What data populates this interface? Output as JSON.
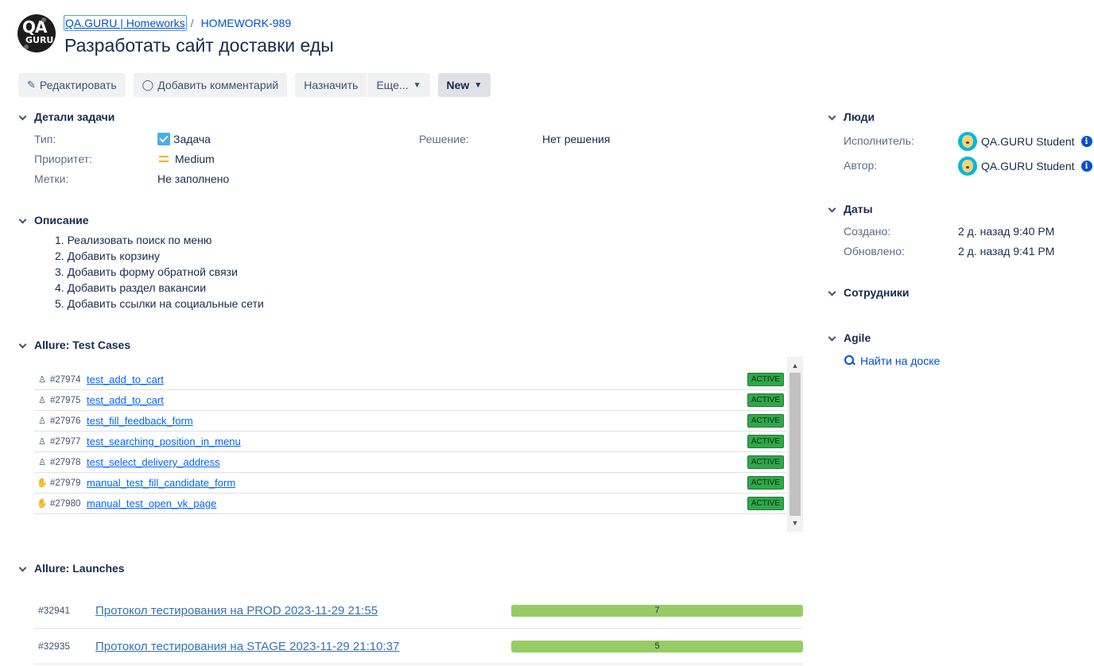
{
  "header": {
    "project_logo_text": "QA GURU",
    "project_name": "QA.GURU | Homeworks",
    "separator": "/",
    "issue_key": "HOMEWORK-989",
    "summary": "Разработать сайт доставки еды"
  },
  "toolbar": {
    "edit": "Редактировать",
    "comment": "Добавить комментарий",
    "assign": "Назначить",
    "more": "Еще...",
    "status": "New"
  },
  "details": {
    "title": "Детали задачи",
    "type_label": "Тип:",
    "type_value": "Задача",
    "priority_label": "Приоритет:",
    "priority_value": "Medium",
    "labels_label": "Метки:",
    "labels_value": "Не заполнено",
    "resolution_label": "Решение:",
    "resolution_value": "Нет решения"
  },
  "description": {
    "title": "Описание",
    "items": [
      "1. Реализовать поиск по меню",
      "2. Добавить корзину",
      "3. Добавить форму обратной связи",
      "4. Добавить раздел вакансии",
      "5. Добавить ссылки на социальные сети"
    ]
  },
  "test_cases": {
    "title": "Allure: Test Cases",
    "rows": [
      {
        "kind": "automated-icon",
        "id": "#27974",
        "name": "test_add_to_cart",
        "status": "ACTIVE"
      },
      {
        "kind": "automated-icon",
        "id": "#27975",
        "name": "test_add_to_cart",
        "status": "ACTIVE"
      },
      {
        "kind": "automated-icon",
        "id": "#27976",
        "name": "test_fill_feedback_form",
        "status": "ACTIVE"
      },
      {
        "kind": "automated-icon",
        "id": "#27977",
        "name": "test_searching_position_in_menu",
        "status": "ACTIVE"
      },
      {
        "kind": "automated-icon",
        "id": "#27978",
        "name": "test_select_delivery_address",
        "status": "ACTIVE"
      },
      {
        "kind": "manual-icon",
        "id": "#27979",
        "name": "manual_test_fill_candidate_form",
        "status": "ACTIVE"
      },
      {
        "kind": "manual-icon",
        "id": "#27980",
        "name": "manual_test_open_vk_page",
        "status": "ACTIVE"
      }
    ]
  },
  "launches": {
    "title": "Allure: Launches",
    "rows": [
      {
        "id": "#32941",
        "name": "Протокол тестирования на PROD 2023-11-29 21:55",
        "passed": "7"
      },
      {
        "id": "#32935",
        "name": "Протокол тестирования на STAGE 2023-11-29 21:10:37",
        "passed": "5"
      }
    ]
  },
  "people": {
    "title": "Люди",
    "assignee_label": "Исполнитель:",
    "assignee": "QA.GURU Student",
    "reporter_label": "Автор:",
    "reporter": "QA.GURU Student"
  },
  "dates": {
    "title": "Даты",
    "created_label": "Создано:",
    "created": "2 д. назад 9:40 PM",
    "updated_label": "Обновлено:",
    "updated": "2 д. назад 9:41 PM"
  },
  "employees": {
    "title": "Сотрудники"
  },
  "agile": {
    "title": "Agile",
    "board_link": "Найти на доске"
  },
  "colors": {
    "link": "#0052cc",
    "active_badge": "#2fa84a",
    "launch_bar": "#97cc64",
    "priority_medium": "#ffab00"
  }
}
